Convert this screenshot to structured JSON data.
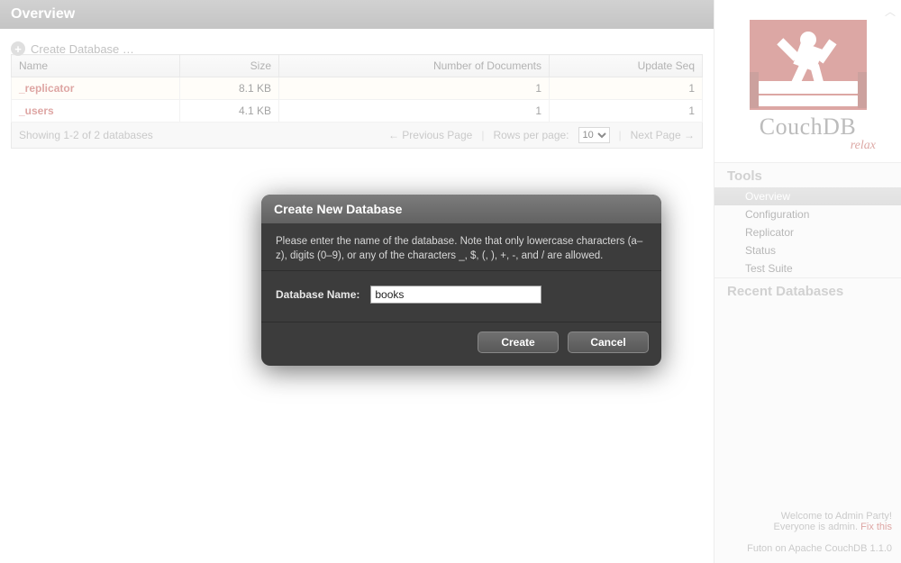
{
  "header": {
    "title": "Overview"
  },
  "toolbar": {
    "create_db_label": "Create Database …"
  },
  "table": {
    "headers": {
      "name": "Name",
      "size": "Size",
      "docs": "Number of Documents",
      "seq": "Update Seq"
    },
    "rows": [
      {
        "name": "_replicator",
        "size": "8.1 KB",
        "docs": "1",
        "seq": "1"
      },
      {
        "name": "_users",
        "size": "4.1 KB",
        "docs": "1",
        "seq": "1"
      }
    ]
  },
  "pager": {
    "showing": "Showing 1-2 of 2 databases",
    "prev": "← Previous Page",
    "rows_per_page_label": "Rows per page:",
    "rows_per_page_value": "10",
    "next": "Next Page →"
  },
  "sidebar": {
    "product": "CouchDB",
    "tagline": "relax",
    "tools_title": "Tools",
    "tools": [
      {
        "label": "Overview",
        "active": true
      },
      {
        "label": "Configuration",
        "active": false
      },
      {
        "label": "Replicator",
        "active": false
      },
      {
        "label": "Status",
        "active": false
      },
      {
        "label": "Test Suite",
        "active": false
      }
    ],
    "recent_title": "Recent Databases",
    "footer": {
      "line1a": "Welcome to Admin Party!",
      "line1b": "Everyone is admin.",
      "fix": "Fix this",
      "line2": "Futon on Apache CouchDB 1.1.0"
    }
  },
  "dialog": {
    "title": "Create New Database",
    "instructions": "Please enter the name of the database. Note that only lowercase characters (a–z), digits (0–9), or any of the characters _, $, (, ), +, -, and / are allowed.",
    "field_label": "Database Name:",
    "field_value": "books",
    "create": "Create",
    "cancel": "Cancel"
  }
}
